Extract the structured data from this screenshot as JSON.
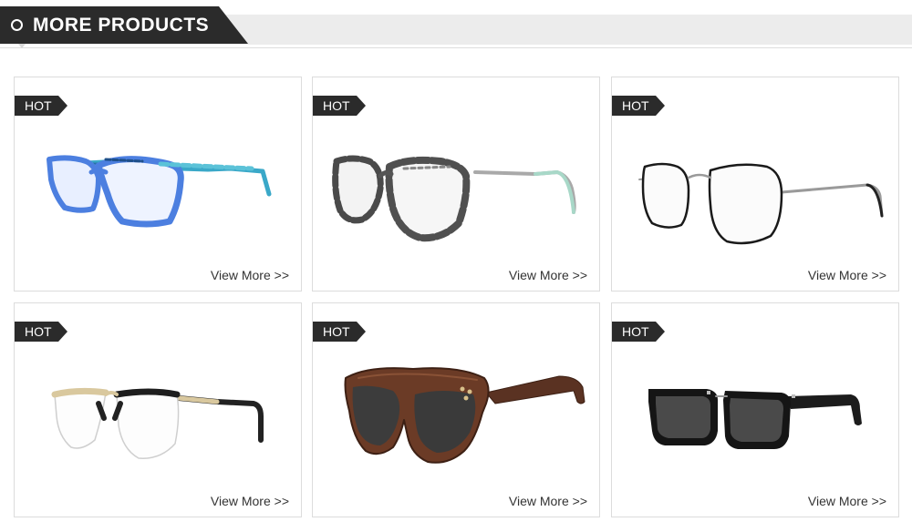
{
  "header": {
    "title": "MORE PRODUCTS",
    "icon": "circle-icon"
  },
  "products": [
    {
      "badge": "HOT",
      "link_label": "View More >>",
      "image": "blue-acetate-eyeglasses"
    },
    {
      "badge": "HOT",
      "link_label": "View More >>",
      "image": "tortoise-cat-eye-eyeglasses"
    },
    {
      "badge": "HOT",
      "link_label": "View More >>",
      "image": "round-metal-eyeglasses"
    },
    {
      "badge": "HOT",
      "link_label": "View More >>",
      "image": "browline-eyeglasses"
    },
    {
      "badge": "HOT",
      "link_label": "View More >>",
      "image": "wooden-sunglasses"
    },
    {
      "badge": "HOT",
      "link_label": "View More >>",
      "image": "square-black-sunglasses"
    }
  ],
  "colors": {
    "dark": "#2b2b2b",
    "header_bg": "#ececec",
    "border": "#dcdcdc"
  }
}
